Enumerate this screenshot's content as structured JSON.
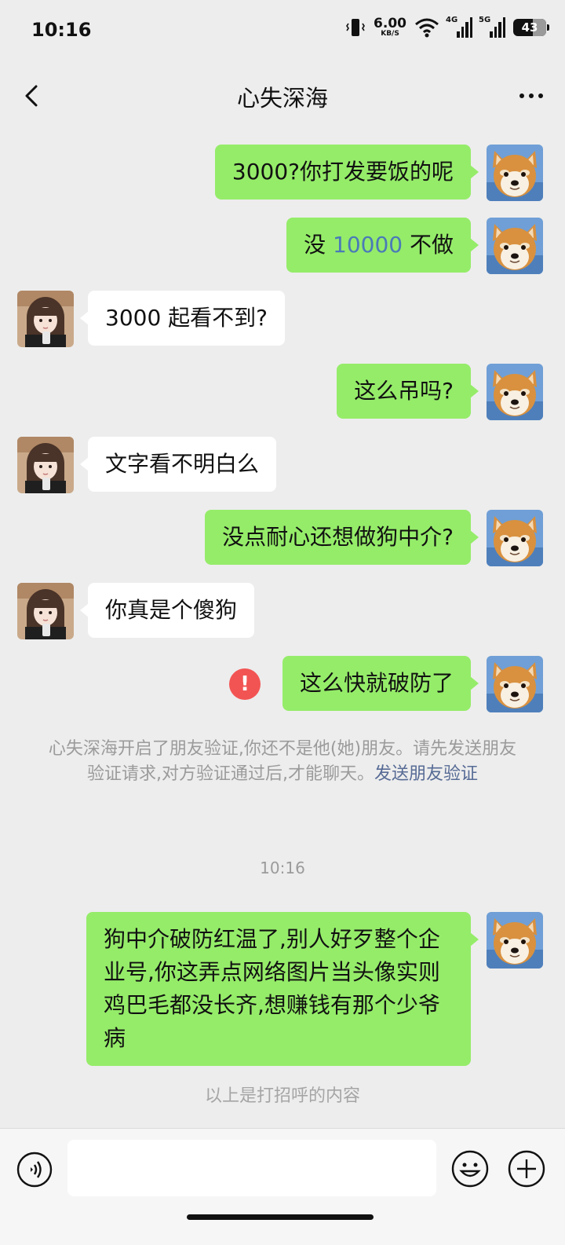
{
  "status_bar": {
    "time": "10:16",
    "net_speed_value": "6.00",
    "net_speed_unit": "KB/S",
    "signal1_tag": "4G",
    "signal2_tag": "5G",
    "battery": "43"
  },
  "header": {
    "title": "心失深海",
    "back_icon": "chevron-left-icon",
    "more_icon": "more-dots-icon"
  },
  "messages": [
    {
      "side": "me",
      "text": "3000?你打发要饭的呢"
    },
    {
      "side": "me",
      "text_before": "没 ",
      "highlight": "10000",
      "text_after": " 不做"
    },
    {
      "side": "other",
      "text": "3000 起看不到?"
    },
    {
      "side": "me",
      "text": "这么吊吗?"
    },
    {
      "side": "other",
      "text": "文字看不明白么"
    },
    {
      "side": "me",
      "text": "没点耐心还想做狗中介?"
    },
    {
      "side": "other",
      "text": "你真是个傻狗"
    },
    {
      "side": "me",
      "text": "这么快就破防了",
      "failed": true,
      "status_icon": "error-icon"
    }
  ],
  "system_notice": {
    "text": "心失深海开启了朋友验证,你还不是他(她)朋友。请先发送朋友验证请求,对方验证通过后,才能聊天。",
    "link": "发送朋友验证"
  },
  "timestamp": "10:16",
  "greeting_message": {
    "side": "me",
    "text": "狗中介破防红温了,别人好歹整个企业号,你这弄点网络图片当头像实则鸡巴毛都没长齐,想赚钱有那个少爷病"
  },
  "greeting_hint": "以上是打招呼的内容",
  "input_bar": {
    "value": "",
    "voice_icon": "voice-icon",
    "emoji_icon": "emoji-icon",
    "plus_icon": "plus-icon"
  },
  "colors": {
    "sent_bubble": "#95ec69",
    "received_bubble": "#ffffff",
    "background": "#ededed",
    "link": "#576b95",
    "error": "#f25453"
  }
}
